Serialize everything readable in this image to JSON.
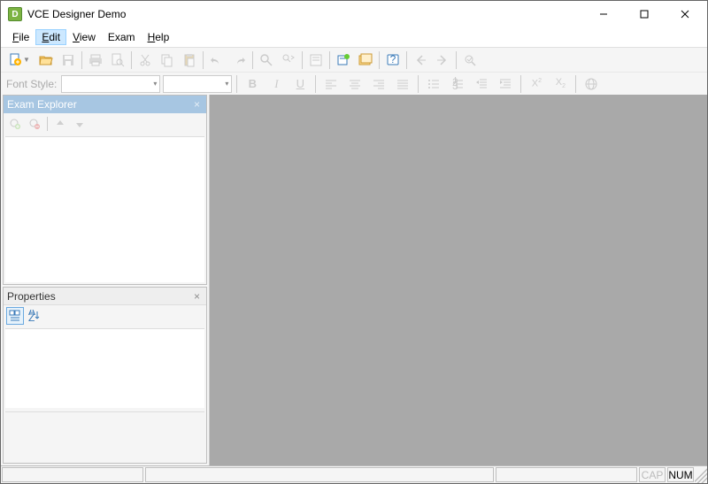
{
  "window": {
    "title": "VCE Designer Demo"
  },
  "menu": {
    "file": "File",
    "edit": "Edit",
    "view": "View",
    "exam": "Exam",
    "help": "Help"
  },
  "format_toolbar": {
    "font_style_label": "Font Style:"
  },
  "panels": {
    "explorer_title": "Exam Explorer",
    "properties_title": "Properties"
  },
  "statusbar": {
    "cap": "CAP",
    "num": "NUM"
  }
}
